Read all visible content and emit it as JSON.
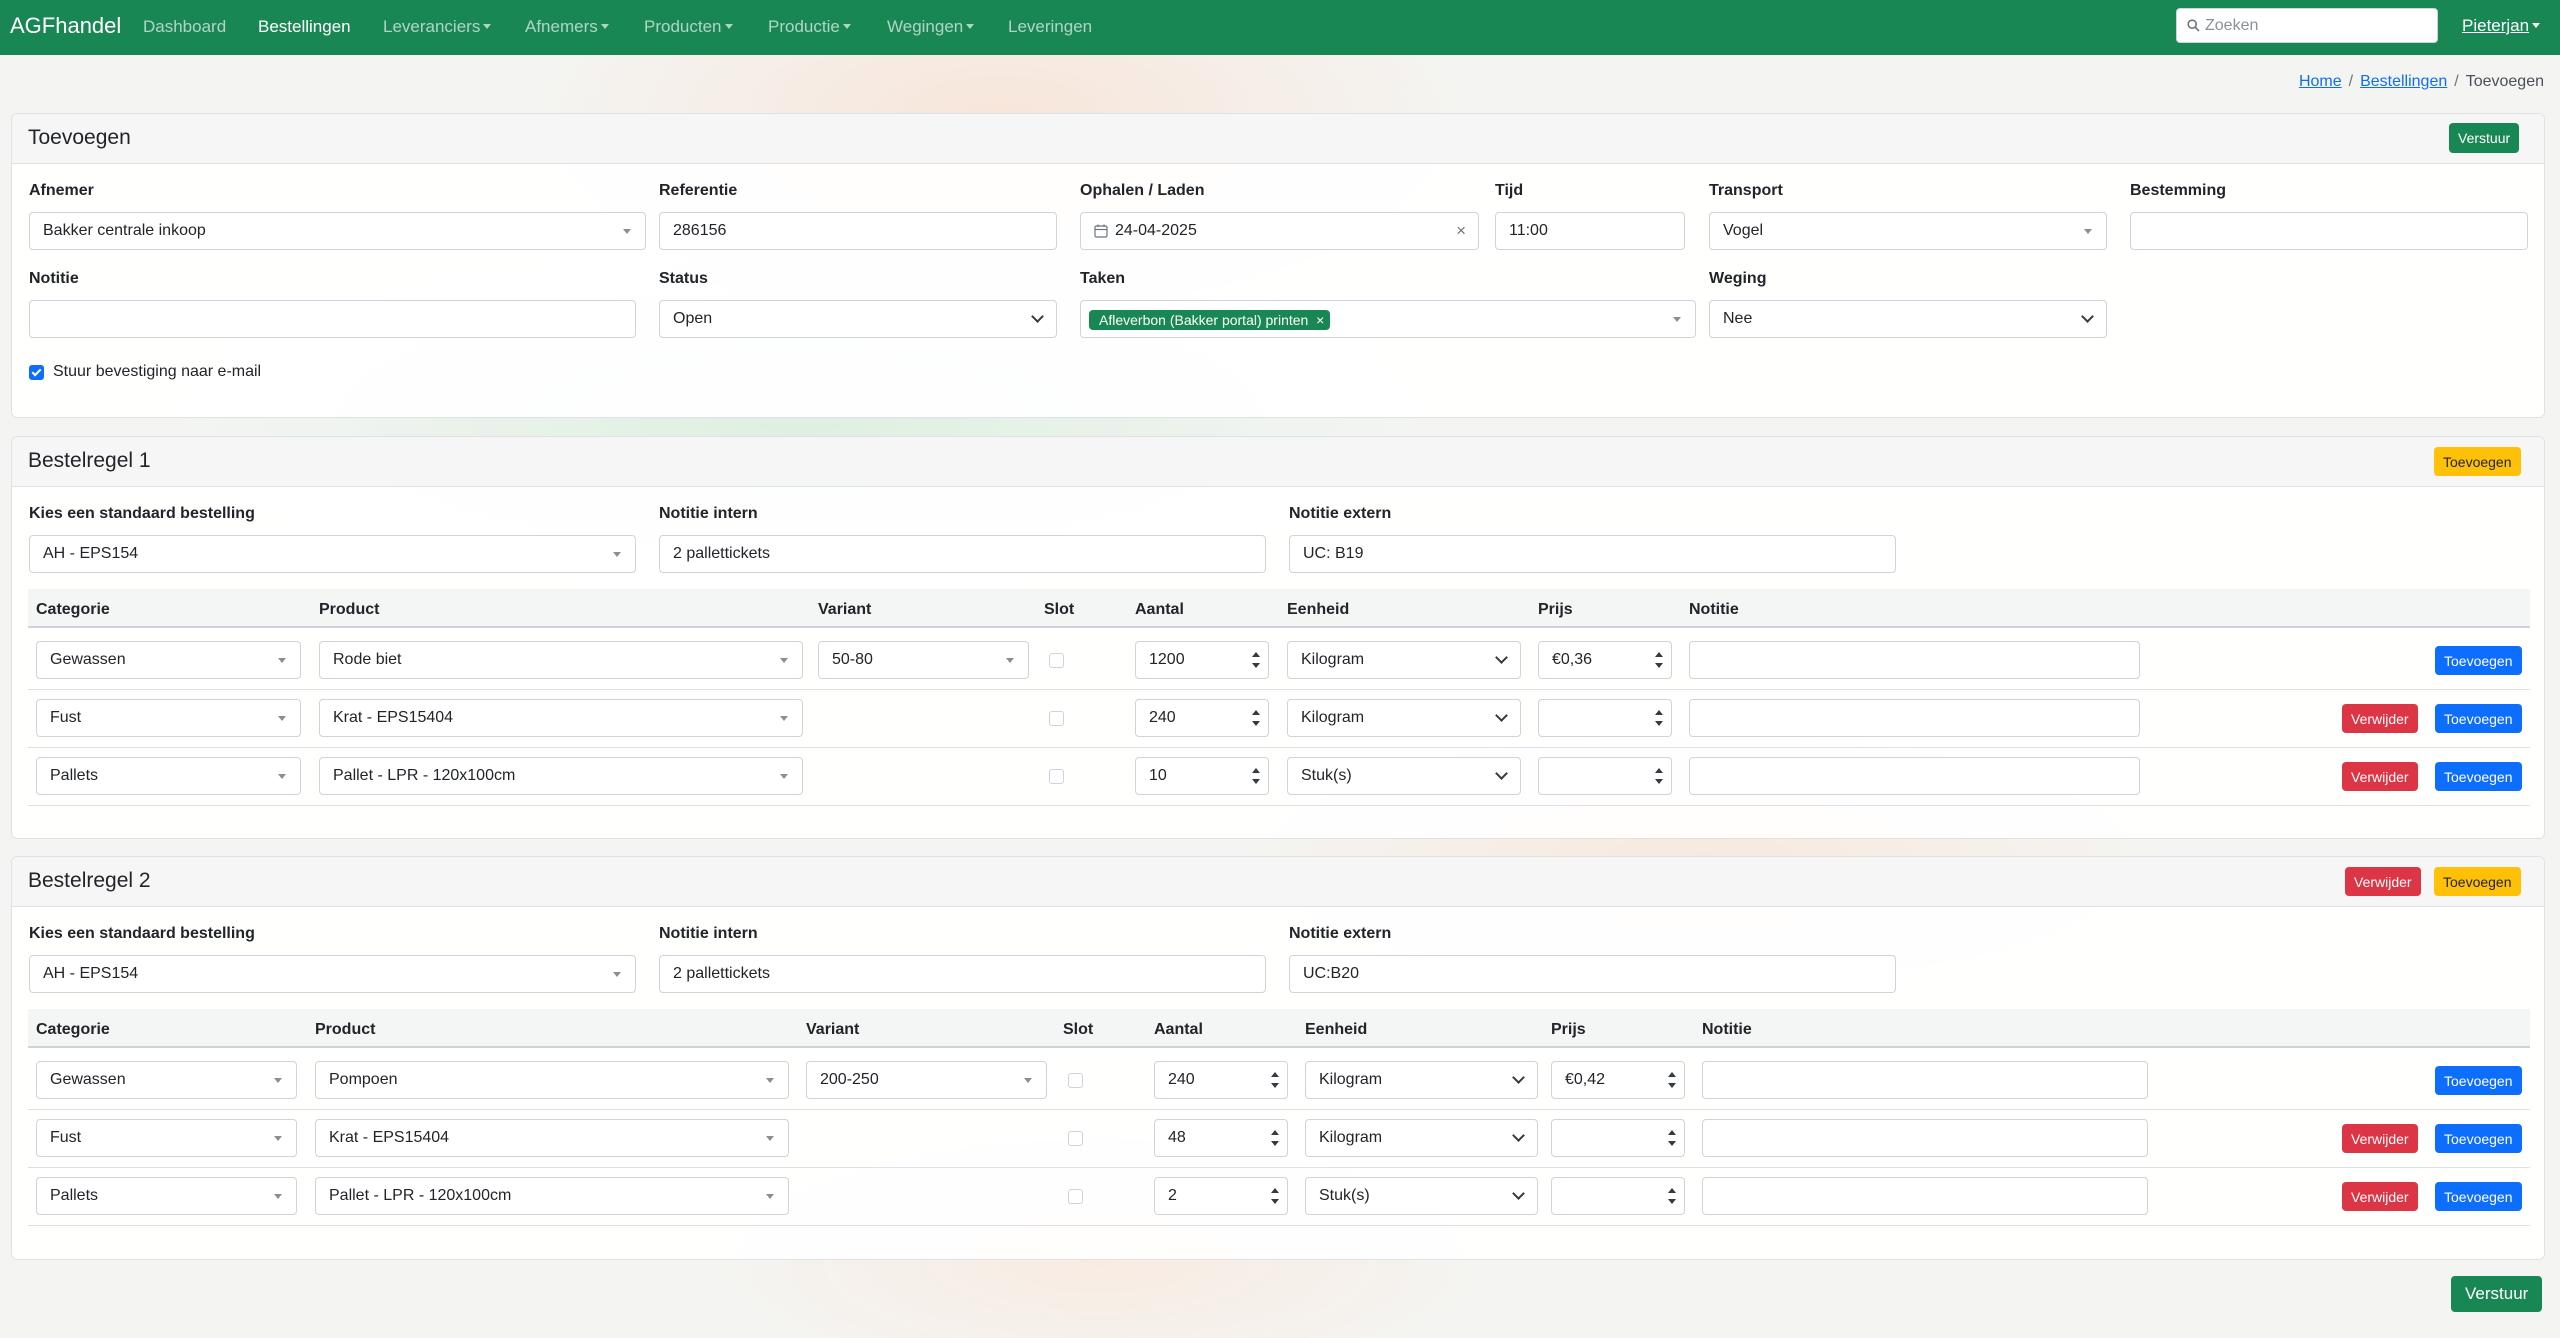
{
  "nav": {
    "brand": "AGFhandel",
    "items": [
      "Dashboard",
      "Bestellingen",
      "Leveranciers",
      "Afnemers",
      "Producten",
      "Productie",
      "Wegingen",
      "Leveringen"
    ],
    "search_placeholder": "Zoeken",
    "user": "Pieterjan"
  },
  "breadcrumb": {
    "home": "Home",
    "orders": "Bestellingen",
    "current": "Toevoegen"
  },
  "form": {
    "title": "Toevoegen",
    "submit": "Verstuur",
    "labels": {
      "afnemer": "Afnemer",
      "referentie": "Referentie",
      "ophalen": "Ophalen / Laden",
      "tijd": "Tijd",
      "transport": "Transport",
      "bestemming": "Bestemming",
      "notitie": "Notitie",
      "status": "Status",
      "taken": "Taken",
      "weging": "Weging"
    },
    "values": {
      "afnemer": "Bakker centrale inkoop",
      "referentie": "286156",
      "ophalen": "24-04-2025",
      "tijd": "11:00",
      "transport": "Vogel",
      "bestemming": "",
      "notitie": "",
      "status": "Open",
      "taak": "Afleverbon (Bakker portal) printen",
      "weging": "Nee"
    },
    "email_label": "Stuur bevestiging naar e-mail"
  },
  "orderlines": [
    {
      "title": "Bestelregel 1",
      "add_label": "Toevoegen",
      "labels": {
        "standard": "Kies een standaard bestelling",
        "intern": "Notitie intern",
        "extern": "Notitie extern"
      },
      "standard": "AH - EPS154",
      "intern": "2 pallettickets",
      "extern": "UC: B19",
      "columns": [
        "Categorie",
        "Product",
        "Variant",
        "Slot",
        "Aantal",
        "Eenheid",
        "Prijs",
        "Notitie"
      ],
      "rows": [
        {
          "categorie": "Gewassen",
          "product": "Rode biet",
          "variant": "50-80",
          "aantal": "1200",
          "eenheid": "Kilogram",
          "prijs": "€0,36",
          "notitie": ""
        },
        {
          "categorie": "Fust",
          "product": "Krat - EPS15404",
          "variant": "",
          "aantal": "240",
          "eenheid": "Kilogram",
          "prijs": "",
          "notitie": ""
        },
        {
          "categorie": "Pallets",
          "product": "Pallet - LPR - 120x100cm",
          "variant": "",
          "aantal": "10",
          "eenheid": "Stuk(s)",
          "prijs": "",
          "notitie": ""
        }
      ]
    },
    {
      "title": "Bestelregel 2",
      "add_label": "Toevoegen",
      "remove_label": "Verwijder",
      "labels": {
        "standard": "Kies een standaard bestelling",
        "intern": "Notitie intern",
        "extern": "Notitie extern"
      },
      "standard": "AH - EPS154",
      "intern": "2 pallettickets",
      "extern": "UC:B20",
      "columns": [
        "Categorie",
        "Product",
        "Variant",
        "Slot",
        "Aantal",
        "Eenheid",
        "Prijs",
        "Notitie"
      ],
      "rows": [
        {
          "categorie": "Gewassen",
          "product": "Pompoen",
          "variant": "200-250",
          "aantal": "240",
          "eenheid": "Kilogram",
          "prijs": "€0,42",
          "notitie": ""
        },
        {
          "categorie": "Fust",
          "product": "Krat - EPS15404",
          "variant": "",
          "aantal": "48",
          "eenheid": "Kilogram",
          "prijs": "",
          "notitie": ""
        },
        {
          "categorie": "Pallets",
          "product": "Pallet - LPR - 120x100cm",
          "variant": "",
          "aantal": "2",
          "eenheid": "Stuk(s)",
          "prijs": "",
          "notitie": ""
        }
      ]
    }
  ],
  "row_buttons": {
    "remove": "Verwijder",
    "add": "Toevoegen"
  },
  "footer_submit": "Verstuur",
  "colors": {
    "green": "#198754",
    "blue": "#0d6efd",
    "red": "#dc3545",
    "yellow": "#ffc107"
  },
  "icons": [
    "search-icon",
    "calendar-icon",
    "clear-icon",
    "chevron-down-icon",
    "dropdown-caret-icon",
    "checkbox-icon",
    "spinner-arrows-icon"
  ]
}
